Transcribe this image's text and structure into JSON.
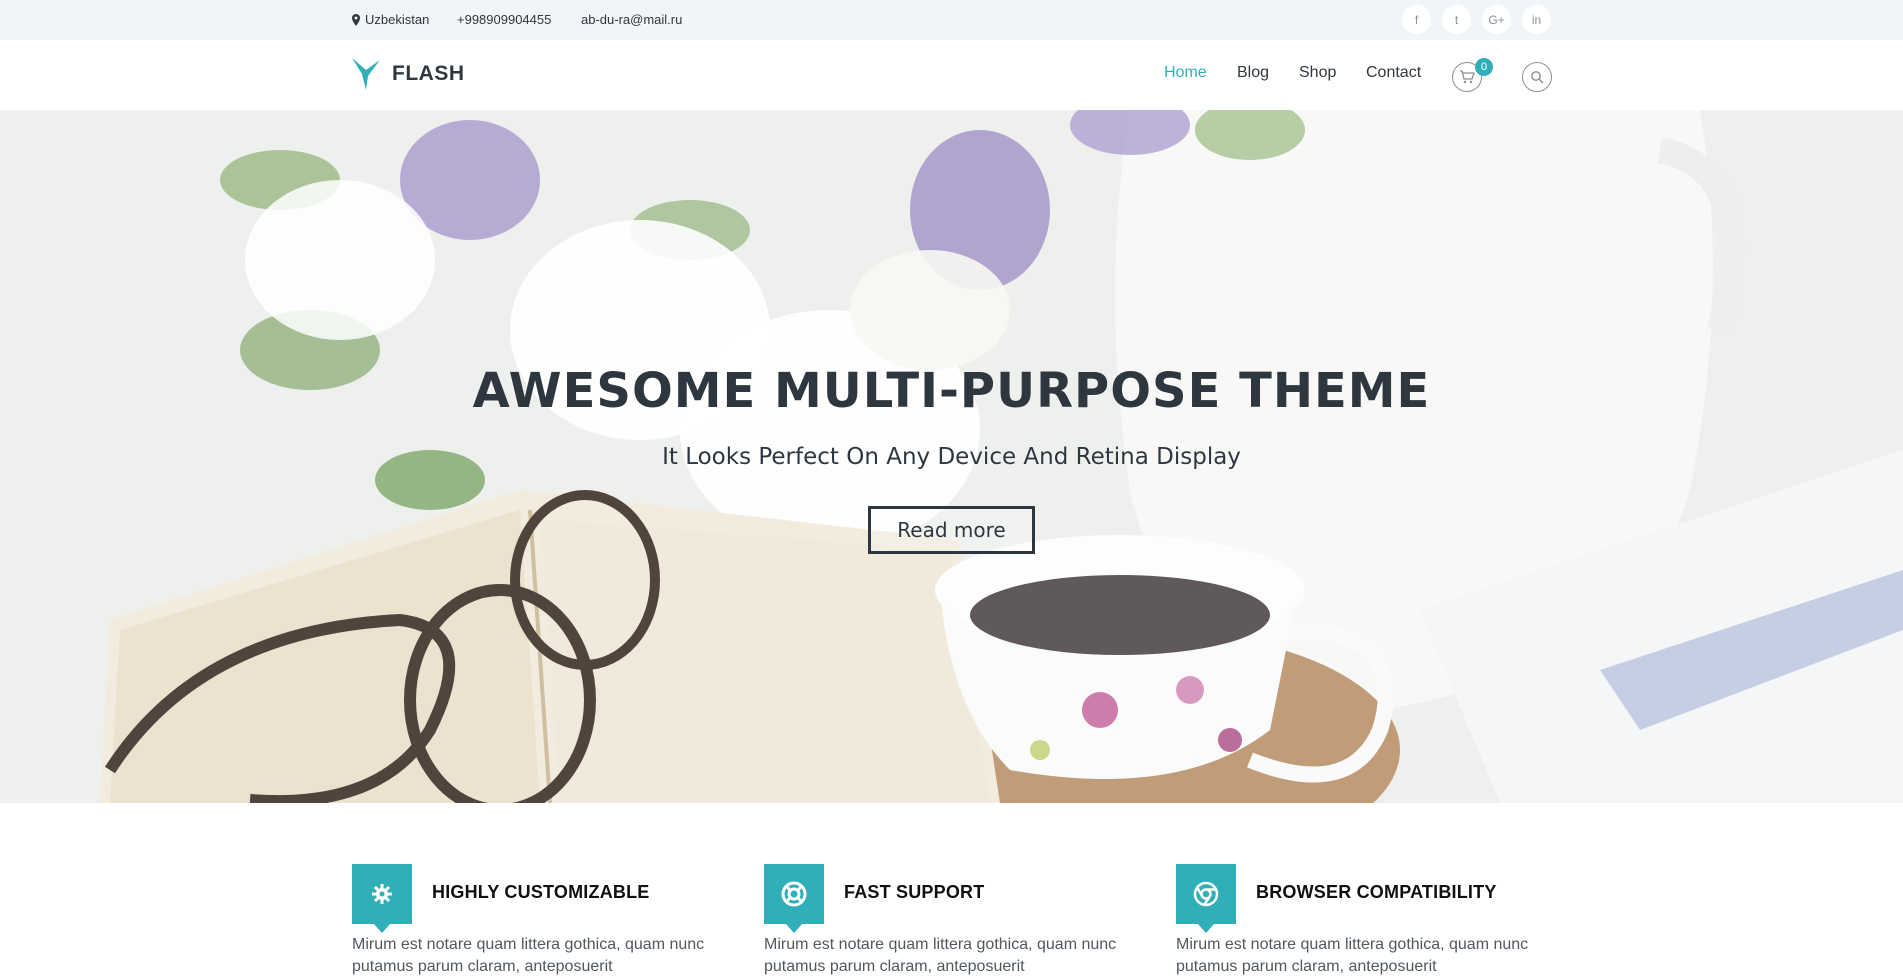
{
  "topbar": {
    "location": "Uzbekistan",
    "phone": "+998909904455",
    "email": "ab-du-ra@mail.ru",
    "social": [
      {
        "icon": "facebook-icon",
        "label": "f"
      },
      {
        "icon": "twitter-icon",
        "label": "t"
      },
      {
        "icon": "google-plus-icon",
        "label": "G+"
      },
      {
        "icon": "linkedin-icon",
        "label": "in"
      }
    ]
  },
  "header": {
    "logo_text": "FLASH",
    "nav": [
      "Home",
      "Blog",
      "Shop",
      "Contact"
    ],
    "cart_count": "0"
  },
  "hero": {
    "title": "AWESOME MULTI-PURPOSE THEME",
    "subtitle": "It Looks Perfect On Any Device And Retina Display",
    "button": "Read more"
  },
  "features": [
    {
      "icon": "gear-icon",
      "title": "HIGHLY CUSTOMIZABLE",
      "text": "Mirum est notare quam littera gothica, quam nunc putamus parum claram, anteposuerit"
    },
    {
      "icon": "lifebuoy-icon",
      "title": "FAST SUPPORT",
      "text": "Mirum est notare quam littera gothica, quam nunc putamus parum claram, anteposuerit"
    },
    {
      "icon": "chrome-icon",
      "title": "BROWSER COMPATIBILITY",
      "text": "Mirum est notare quam littera gothica, quam nunc putamus parum claram, anteposuerit"
    }
  ],
  "colors": {
    "accent": "#30afb8",
    "text": "#30373e",
    "topbar_bg": "#f2f5f8"
  }
}
